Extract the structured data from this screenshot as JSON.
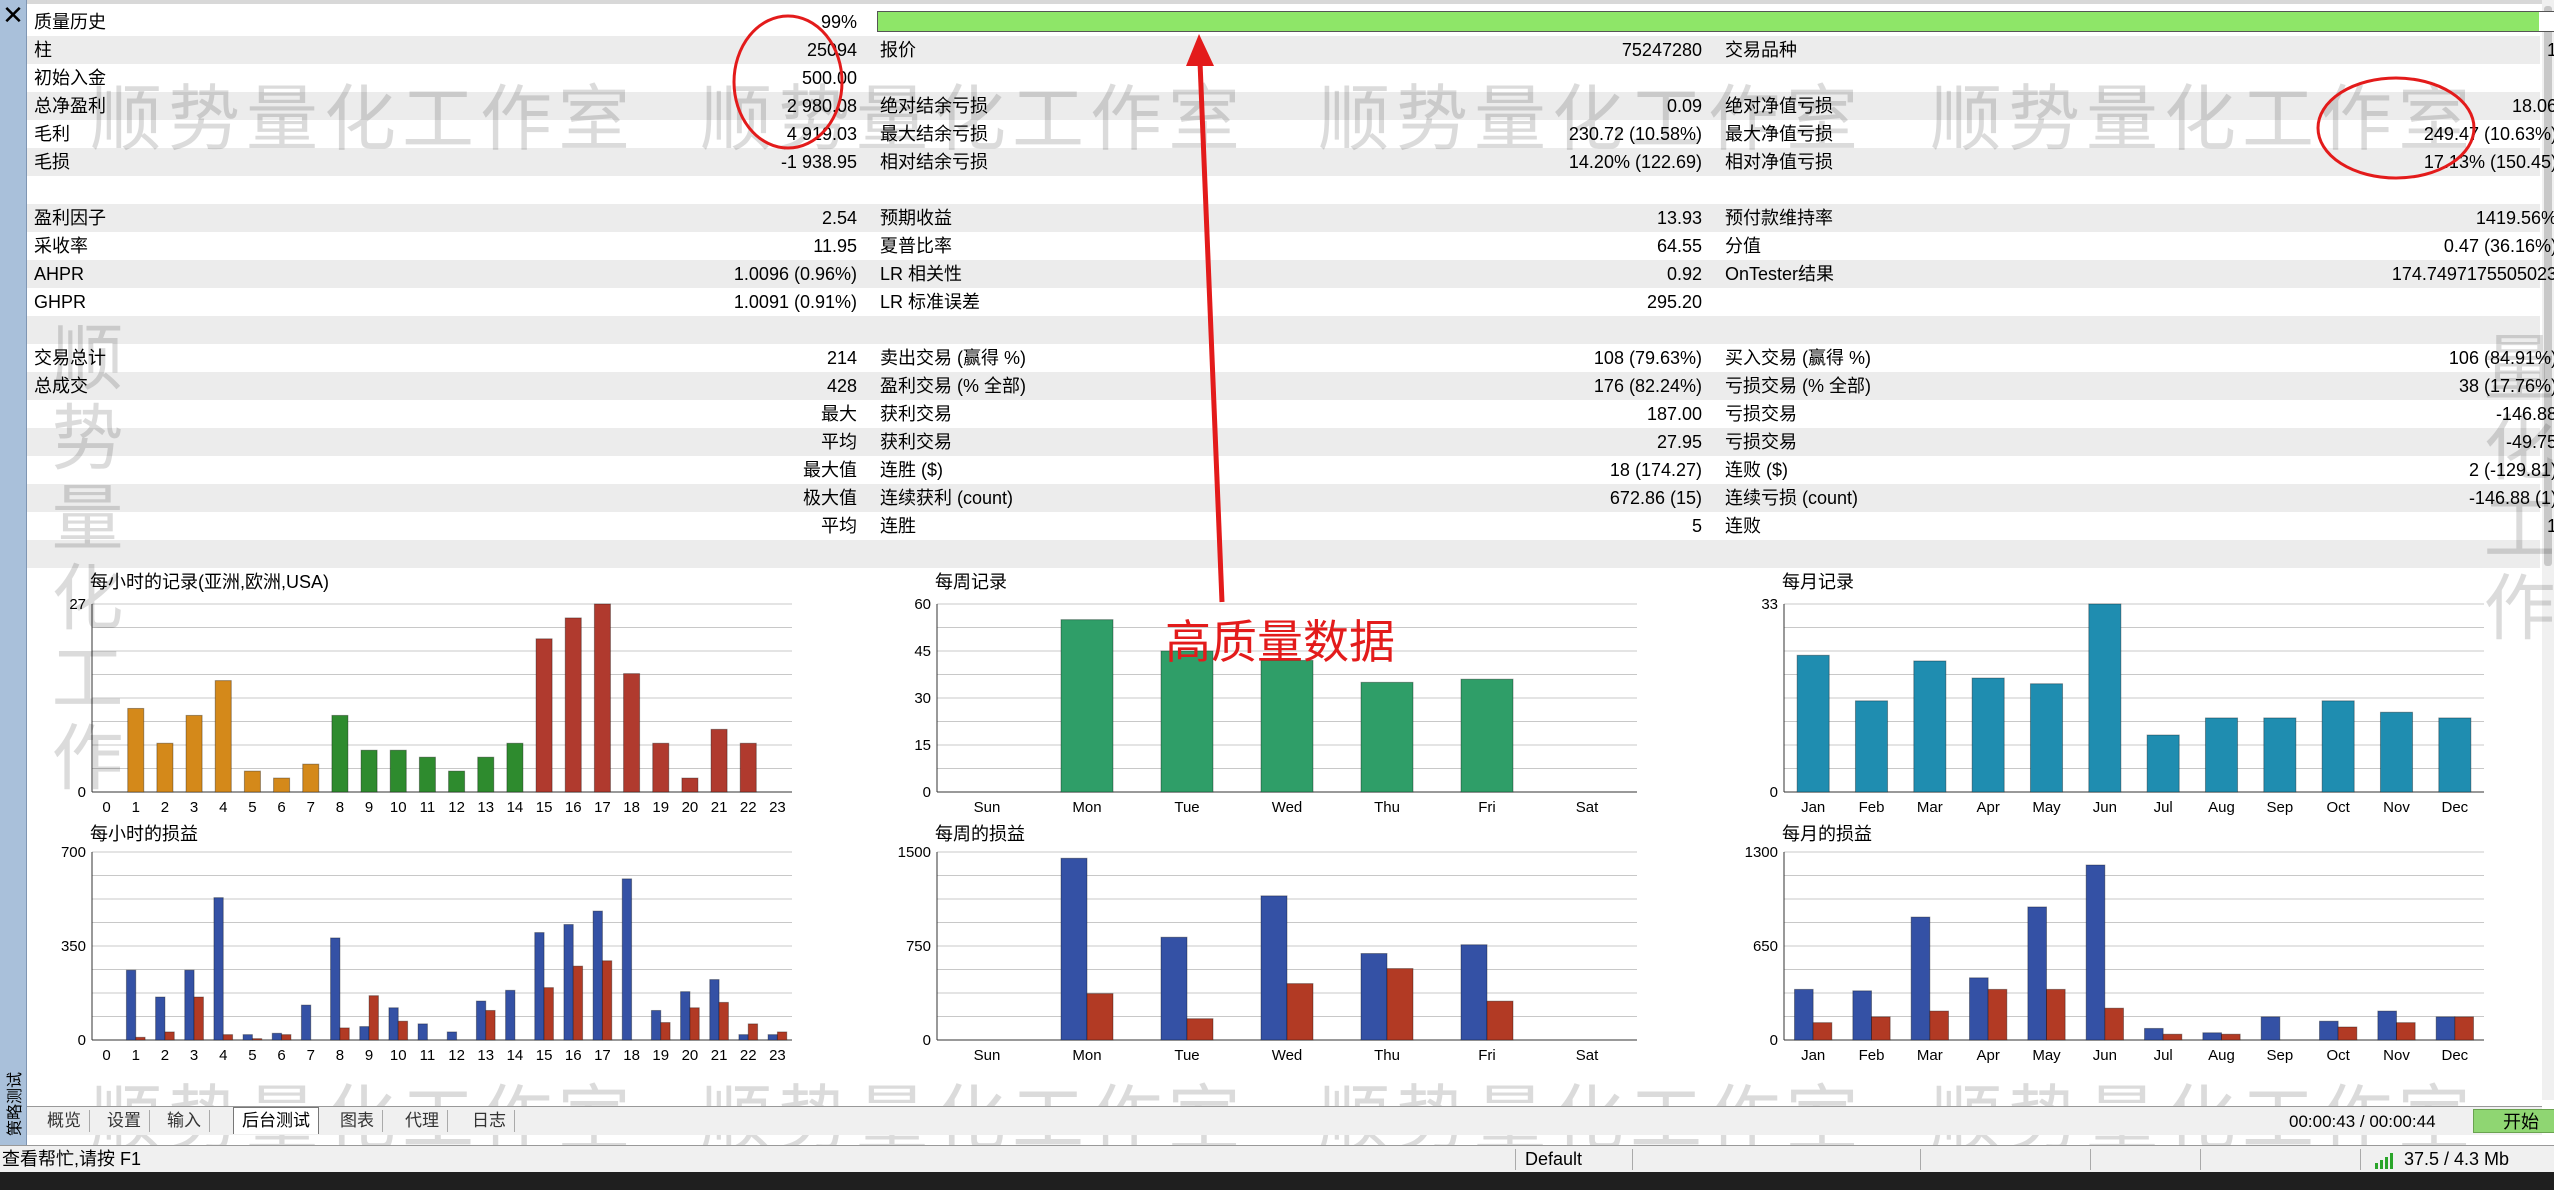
{
  "window": {
    "close_glyph": "✕",
    "panel_title": "策略测试"
  },
  "stats": {
    "quality_label": "质量历史",
    "quality_value": "99%",
    "quality_fraction": 0.99,
    "r1": [
      "柱",
      "25094",
      "报价",
      "75247280",
      "交易品种",
      "1"
    ],
    "r2": [
      "初始入金",
      "500.00"
    ],
    "r3": [
      "总净盈利",
      "2 980.08",
      "绝对结余亏损",
      "0.09",
      "绝对净值亏损",
      "18.06"
    ],
    "r4": [
      "毛利",
      "4 919.03",
      "最大结余亏损",
      "230.72 (10.58%)",
      "最大净值亏损",
      "249.47 (10.63%)"
    ],
    "r5": [
      "毛损",
      "-1 938.95",
      "相对结余亏损",
      "14.20% (122.69)",
      "相对净值亏损",
      "17.13% (150.45)"
    ],
    "r6": [
      "盈利因子",
      "2.54",
      "预期收益",
      "13.93",
      "预付款维持率",
      "1419.56%"
    ],
    "r7": [
      "采收率",
      "11.95",
      "夏普比率",
      "64.55",
      "分值",
      "0.47 (36.16%)"
    ],
    "r8": [
      "AHPR",
      "1.0096 (0.96%)",
      "LR 相关性",
      "0.92",
      "OnTester结果",
      "174.7497175505023"
    ],
    "r9": [
      "GHPR",
      "1.0091 (0.91%)",
      "LR 标准误差",
      "295.20"
    ],
    "r10": [
      "交易总计",
      "214",
      "卖出交易 (赢得 %)",
      "108 (79.63%)",
      "买入交易 (赢得 %)",
      "106 (84.91%)"
    ],
    "r11": [
      "总成交",
      "428",
      "盈利交易 (% 全部)",
      "176 (82.24%)",
      "亏损交易 (% 全部)",
      "38 (17.76%)"
    ],
    "r12": [
      "最大",
      "获利交易",
      "187.00",
      "亏损交易",
      "-146.88"
    ],
    "r13": [
      "平均",
      "获利交易",
      "27.95",
      "亏损交易",
      "-49.75"
    ],
    "r14": [
      "最大值",
      "连胜 ($)",
      "18 (174.27)",
      "连败 ($)",
      "2 (-129.81)"
    ],
    "r15": [
      "极大值",
      "连续获利 (count)",
      "672.86 (15)",
      "连续亏损 (count)",
      "-146.88 (1)"
    ],
    "r16": [
      "平均",
      "连胜",
      "5",
      "连败",
      "1"
    ]
  },
  "annotation": {
    "text": "高质量数据"
  },
  "watermark": {
    "text": "顺势量化工作室",
    "vertical_left": "顺势量化工作",
    "vertical_right": "量化工作"
  },
  "colors": {
    "orange": "#d4891a",
    "green": "#2e8b2e",
    "red": "#b03a2e",
    "teal": "#2f9e68",
    "cyan": "#1f8db0",
    "blue": "#3451a5",
    "lossred": "#b23a24",
    "annot": "#e31b1b"
  },
  "chart_data": [
    {
      "id": "hourly_records",
      "type": "bar",
      "title": "每小时的记录(亚洲,欧洲,USA)",
      "categories": [
        "0",
        "1",
        "2",
        "3",
        "4",
        "5",
        "6",
        "7",
        "8",
        "9",
        "10",
        "11",
        "12",
        "13",
        "14",
        "15",
        "16",
        "17",
        "18",
        "19",
        "20",
        "21",
        "22",
        "23"
      ],
      "values": [
        0,
        12,
        7,
        11,
        16,
        3,
        2,
        4,
        11,
        6,
        6,
        5,
        3,
        5,
        7,
        22,
        25,
        27,
        17,
        7,
        2,
        9,
        7,
        0
      ],
      "ylim": [
        0,
        27
      ],
      "yticks": [
        "0",
        "27"
      ]
    },
    {
      "id": "weekly_records",
      "type": "bar",
      "title": "每周记录",
      "categories": [
        "Sun",
        "Mon",
        "Tue",
        "Wed",
        "Thu",
        "Fri",
        "Sat"
      ],
      "values": [
        0,
        55,
        45,
        42,
        35,
        36,
        0
      ],
      "ylim": [
        0,
        60
      ],
      "yticks": [
        "0",
        "15",
        "30",
        "45",
        "60"
      ]
    },
    {
      "id": "monthly_records",
      "type": "bar",
      "title": "每月记录",
      "categories": [
        "Jan",
        "Feb",
        "Mar",
        "Apr",
        "May",
        "Jun",
        "Jul",
        "Aug",
        "Sep",
        "Oct",
        "Nov",
        "Dec"
      ],
      "values": [
        24,
        16,
        23,
        20,
        19,
        33,
        10,
        13,
        13,
        16,
        14,
        13
      ],
      "ylim": [
        0,
        33
      ],
      "yticks": [
        "0",
        "33"
      ]
    },
    {
      "id": "hourly_pl",
      "type": "bar",
      "title": "每小时的损益",
      "categories": [
        "0",
        "1",
        "2",
        "3",
        "4",
        "5",
        "6",
        "7",
        "8",
        "9",
        "10",
        "11",
        "12",
        "13",
        "14",
        "15",
        "16",
        "17",
        "18",
        "19",
        "20",
        "21",
        "22",
        "23"
      ],
      "series": [
        {
          "values": [
            0,
            260,
            160,
            260,
            530,
            20,
            25,
            130,
            380,
            50,
            120,
            60,
            30,
            145,
            185,
            400,
            430,
            480,
            600,
            110,
            180,
            225,
            20,
            20
          ]
        },
        {
          "values": [
            0,
            10,
            30,
            160,
            20,
            5,
            20,
            0,
            45,
            165,
            70,
            0,
            0,
            110,
            0,
            195,
            275,
            295,
            0,
            65,
            120,
            140,
            60,
            30
          ]
        }
      ],
      "ylim": [
        0,
        700
      ],
      "yticks": [
        "0",
        "350",
        "700"
      ]
    },
    {
      "id": "weekly_pl",
      "type": "bar",
      "title": "每周的损益",
      "categories": [
        "Sun",
        "Mon",
        "Tue",
        "Wed",
        "Thu",
        "Fri",
        "Sat"
      ],
      "series": [
        {
          "values": [
            0,
            1450,
            820,
            1150,
            690,
            760,
            0
          ]
        },
        {
          "values": [
            0,
            370,
            170,
            450,
            570,
            310,
            0
          ]
        }
      ],
      "ylim": [
        0,
        1500
      ],
      "yticks": [
        "0",
        "750",
        "1500"
      ]
    },
    {
      "id": "monthly_pl",
      "type": "bar",
      "title": "每月的损益",
      "categories": [
        "Jan",
        "Feb",
        "Mar",
        "Apr",
        "May",
        "Jun",
        "Jul",
        "Aug",
        "Sep",
        "Oct",
        "Nov",
        "Dec"
      ],
      "series": [
        {
          "values": [
            350,
            340,
            850,
            430,
            920,
            1210,
            80,
            50,
            160,
            130,
            200,
            160
          ]
        },
        {
          "values": [
            120,
            160,
            200,
            350,
            350,
            220,
            40,
            40,
            0,
            90,
            120,
            160
          ]
        }
      ],
      "ylim": [
        0,
        1300
      ],
      "yticks": [
        "0",
        "650",
        "1300"
      ]
    }
  ],
  "tabs": [
    "概览",
    "设置",
    "输入",
    "后台测试",
    "图表",
    "代理",
    "日志"
  ],
  "active_tab": "后台测试",
  "timer": "00:00:43 / 00:00:44",
  "start_button": "开始",
  "status": {
    "help": "查看帮忙,请按 F1",
    "profile": "Default",
    "memory": "37.5 / 4.3 Mb"
  }
}
